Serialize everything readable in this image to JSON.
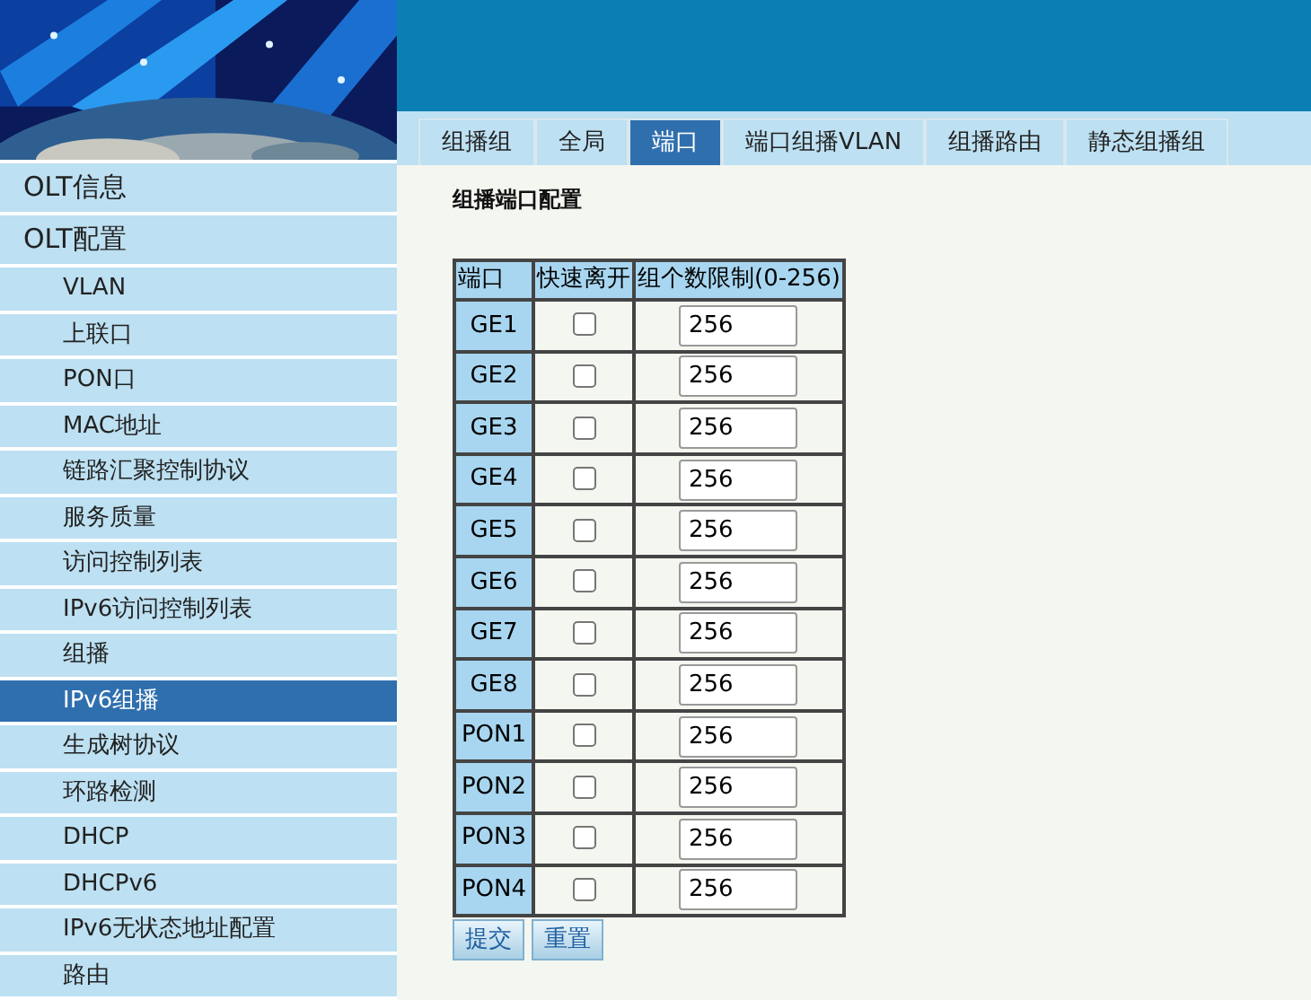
{
  "banner": {
    "kind": "picture"
  },
  "sidebar": {
    "items": [
      {
        "label": "OLT信息",
        "selected": false
      },
      {
        "label": "OLT配置",
        "selected": false,
        "children": [
          {
            "label": "VLAN",
            "selected": false
          },
          {
            "label": "上联口",
            "selected": false
          },
          {
            "label": "PON口",
            "selected": false
          },
          {
            "label": "MAC地址",
            "selected": false
          },
          {
            "label": "链路汇聚控制协议",
            "selected": false
          },
          {
            "label": "服务质量",
            "selected": false
          },
          {
            "label": "访问控制列表",
            "selected": false
          },
          {
            "label": "IPv6访问控制列表",
            "selected": false
          },
          {
            "label": "组播",
            "selected": false
          },
          {
            "label": "IPv6组播",
            "selected": true
          },
          {
            "label": "生成树协议",
            "selected": false
          },
          {
            "label": "环路检测",
            "selected": false
          },
          {
            "label": "DHCP",
            "selected": false
          },
          {
            "label": "DHCPv6",
            "selected": false
          },
          {
            "label": "IPv6无状态地址配置",
            "selected": false
          },
          {
            "label": "路由",
            "selected": false
          }
        ]
      }
    ]
  },
  "tabs": [
    {
      "label": "组播组",
      "selected": false
    },
    {
      "label": "全局",
      "selected": false
    },
    {
      "label": "端口",
      "selected": true
    },
    {
      "label": "端口组播VLAN",
      "selected": false
    },
    {
      "label": "组播路由",
      "selected": false
    },
    {
      "label": "静态组播组",
      "selected": false
    }
  ],
  "section_title": "组播端口配置",
  "table": {
    "columns": [
      "端口",
      "快速离开",
      "组个数限制(0-256)"
    ],
    "rows": [
      {
        "port": "GE1",
        "fast_leave": false,
        "limit": "256"
      },
      {
        "port": "GE2",
        "fast_leave": false,
        "limit": "256"
      },
      {
        "port": "GE3",
        "fast_leave": false,
        "limit": "256"
      },
      {
        "port": "GE4",
        "fast_leave": false,
        "limit": "256"
      },
      {
        "port": "GE5",
        "fast_leave": false,
        "limit": "256"
      },
      {
        "port": "GE6",
        "fast_leave": false,
        "limit": "256"
      },
      {
        "port": "GE7",
        "fast_leave": false,
        "limit": "256"
      },
      {
        "port": "GE8",
        "fast_leave": false,
        "limit": "256"
      },
      {
        "port": "PON1",
        "fast_leave": false,
        "limit": "256"
      },
      {
        "port": "PON2",
        "fast_leave": false,
        "limit": "256"
      },
      {
        "port": "PON3",
        "fast_leave": false,
        "limit": "256"
      },
      {
        "port": "PON4",
        "fast_leave": false,
        "limit": "256"
      }
    ]
  },
  "buttons": [
    "提交",
    "重置"
  ]
}
